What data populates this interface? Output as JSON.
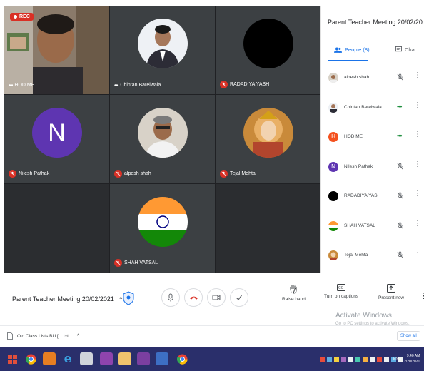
{
  "recording_label": "REC",
  "tiles": [
    {
      "name": "HOD ME",
      "status": "dots"
    },
    {
      "name": "Chintan Barelwala",
      "status": "dots"
    },
    {
      "name": "RADADIYA YASH",
      "status": "muted"
    },
    {
      "name": "Nilesh Pathak",
      "status": "muted",
      "letter": "N"
    },
    {
      "name": "alpesh shah",
      "status": "muted"
    },
    {
      "name": "Tejal Mehta",
      "status": "muted"
    },
    {
      "name": "SHAH VATSAL",
      "status": "muted"
    }
  ],
  "panel": {
    "title": "Parent Teacher Meeting 20/02/20...",
    "people_tab": "People (8)",
    "chat_tab": "Chat",
    "participants": [
      {
        "name": "alpesh shah",
        "state": "muted"
      },
      {
        "name": "Chintan Barelwala",
        "state": "talking"
      },
      {
        "name": "HOD ME",
        "state": "talking",
        "letter": "H"
      },
      {
        "name": "Nilesh Pathak",
        "state": "muted",
        "letter": "N"
      },
      {
        "name": "RADADIYA YASH",
        "state": "muted"
      },
      {
        "name": "SHAH VATSAL",
        "state": "muted"
      },
      {
        "name": "Tejal Mehta",
        "state": "muted"
      }
    ]
  },
  "controls": {
    "meeting_title": "Parent Teacher Meeting 20/02/2021",
    "raise_hand": "Raise hand",
    "captions": "Turn on captions",
    "present": "Present now"
  },
  "watermark": {
    "title": "Activate Windows",
    "subtitle": "Go to PC settings to activate Windows."
  },
  "download": {
    "file": "Old Class Lists BU [....txt",
    "show_all": "Show all"
  },
  "taskbar": {
    "lang": "ENG",
    "time": "9:40 AM",
    "date": "2/20/2021"
  },
  "colors": {
    "accent": "#1a73e8",
    "mute_red": "#d93025",
    "avatar_purple": "#5e35b1",
    "avatar_orange": "#f4511e",
    "taskbar": "#2a2f6b"
  }
}
